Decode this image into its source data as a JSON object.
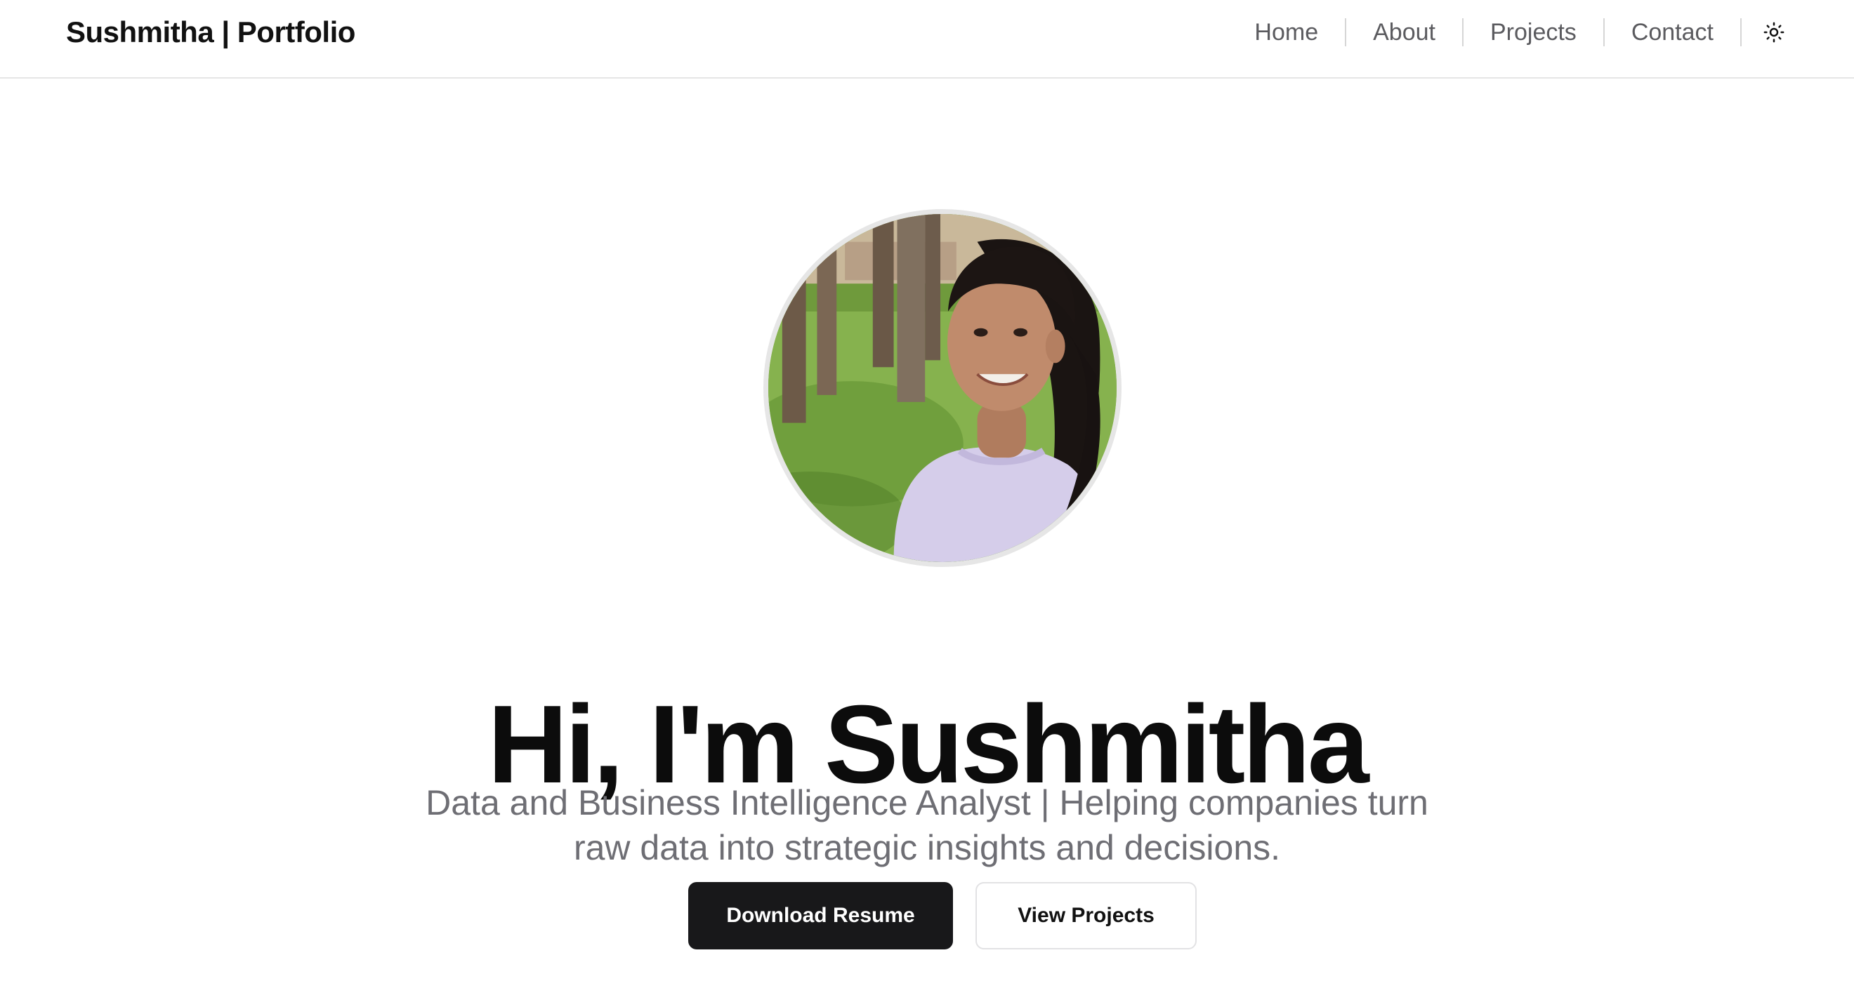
{
  "header": {
    "brand": "Sushmitha | Portfolio",
    "nav": [
      {
        "label": "Home"
      },
      {
        "label": "About"
      },
      {
        "label": "Projects"
      },
      {
        "label": "Contact"
      }
    ],
    "theme_toggle_icon": "sun-icon"
  },
  "hero": {
    "avatar_icon": "profile-photo",
    "title": "Hi, I'm Sushmitha",
    "subtitle": "Data and Business Intelligence Analyst | Helping companies turn raw data into strategic insights and decisions.",
    "primary_button": "Download Resume",
    "secondary_button": "View Projects"
  },
  "colors": {
    "primary_button_bg": "#18181a",
    "text_dark": "#0c0c0c",
    "text_muted": "#6e6e74",
    "border": "#e5e5e5"
  }
}
